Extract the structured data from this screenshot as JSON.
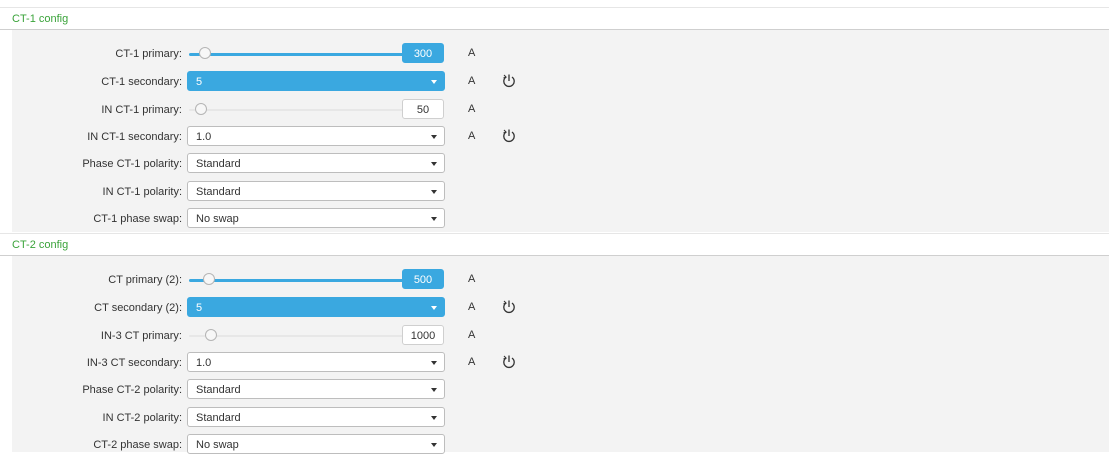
{
  "sections": [
    {
      "title": "CT-1 config",
      "rows": {
        "primary": {
          "label": "CT-1 primary:",
          "value": "300",
          "unit": "A",
          "level": 0.02
        },
        "secondary": {
          "label": "CT-1 secondary:",
          "value": "5",
          "unit": "A"
        },
        "in_primary": {
          "label": "IN CT-1 primary:",
          "value": "50",
          "unit": "A",
          "level": 0.0
        },
        "in_secondary": {
          "label": "IN CT-1 secondary:",
          "value": "1.0",
          "unit": "A"
        },
        "phase_polarity": {
          "label": "Phase CT-1 polarity:",
          "value": "Standard"
        },
        "in_polarity": {
          "label": "IN CT-1 polarity:",
          "value": "Standard"
        },
        "phase_swap": {
          "label": "CT-1 phase swap:",
          "value": "No swap"
        }
      }
    },
    {
      "title": "CT-2 config",
      "rows": {
        "primary": {
          "label": "CT primary (2):",
          "value": "500",
          "unit": "A",
          "level": 0.04
        },
        "secondary": {
          "label": "CT secondary (2):",
          "value": "5",
          "unit": "A"
        },
        "in_primary": {
          "label": "IN-3 CT primary:",
          "value": "1000",
          "unit": "A",
          "level": 0.05
        },
        "in_secondary": {
          "label": "IN-3 CT secondary:",
          "value": "1.0",
          "unit": "A"
        },
        "phase_polarity": {
          "label": "Phase CT-2 polarity:",
          "value": "Standard"
        },
        "in_polarity": {
          "label": "IN CT-2 polarity:",
          "value": "Standard"
        },
        "phase_swap": {
          "label": "CT-2 phase swap:",
          "value": "No swap"
        }
      }
    }
  ],
  "icons": {
    "reset": "power-reset-icon",
    "dropdown": "caret-down-icon"
  },
  "colors": {
    "accent": "#3aa8e0",
    "section_title": "#3aa33a",
    "body_bg": "#f3f3f3"
  }
}
